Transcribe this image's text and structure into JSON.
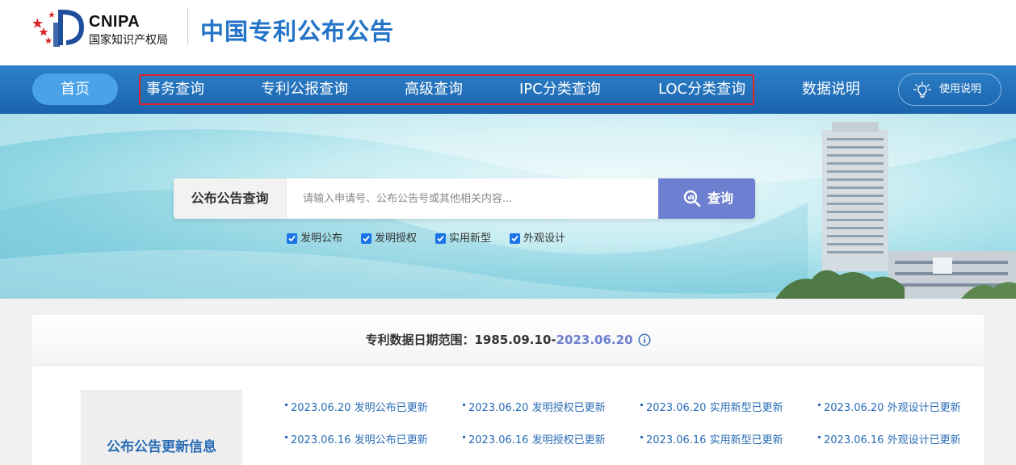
{
  "header": {
    "logo_text": "CNIPA",
    "logo_subtitle": "国家知识产权局",
    "site_title": "中国专利公布公告"
  },
  "nav": {
    "home": "首页",
    "items": [
      "事务查询",
      "专利公报查询",
      "高级查询",
      "IPC分类查询",
      "LOC分类查询",
      "数据说明"
    ],
    "help": "使用说明"
  },
  "search": {
    "label": "公布公告查询",
    "placeholder": "请输入申请号、公布公告号或其他相关内容...",
    "button": "查询",
    "filters": [
      {
        "label": "发明公布",
        "checked": true
      },
      {
        "label": "发明授权",
        "checked": true
      },
      {
        "label": "实用新型",
        "checked": true
      },
      {
        "label": "外观设计",
        "checked": true
      }
    ]
  },
  "data_range": {
    "label": "专利数据日期范围：",
    "start": "1985.09.10-",
    "end": "2023.06.20"
  },
  "updates": {
    "title": "公布公告更新信息",
    "rows": [
      [
        "2023.06.20 发明公布已更新",
        "2023.06.20 发明授权已更新",
        "2023.06.20 实用新型已更新",
        "2023.06.20 外观设计已更新"
      ],
      [
        "2023.06.16 发明公布已更新",
        "2023.06.16 发明授权已更新",
        "2023.06.16 实用新型已更新",
        "2023.06.16 外观设计已更新"
      ]
    ]
  },
  "colors": {
    "brand_blue": "#2373c8",
    "nav_blue": "#1b63ad",
    "highlight_red": "#e0242b",
    "button_purple": "#6d7fd0"
  }
}
